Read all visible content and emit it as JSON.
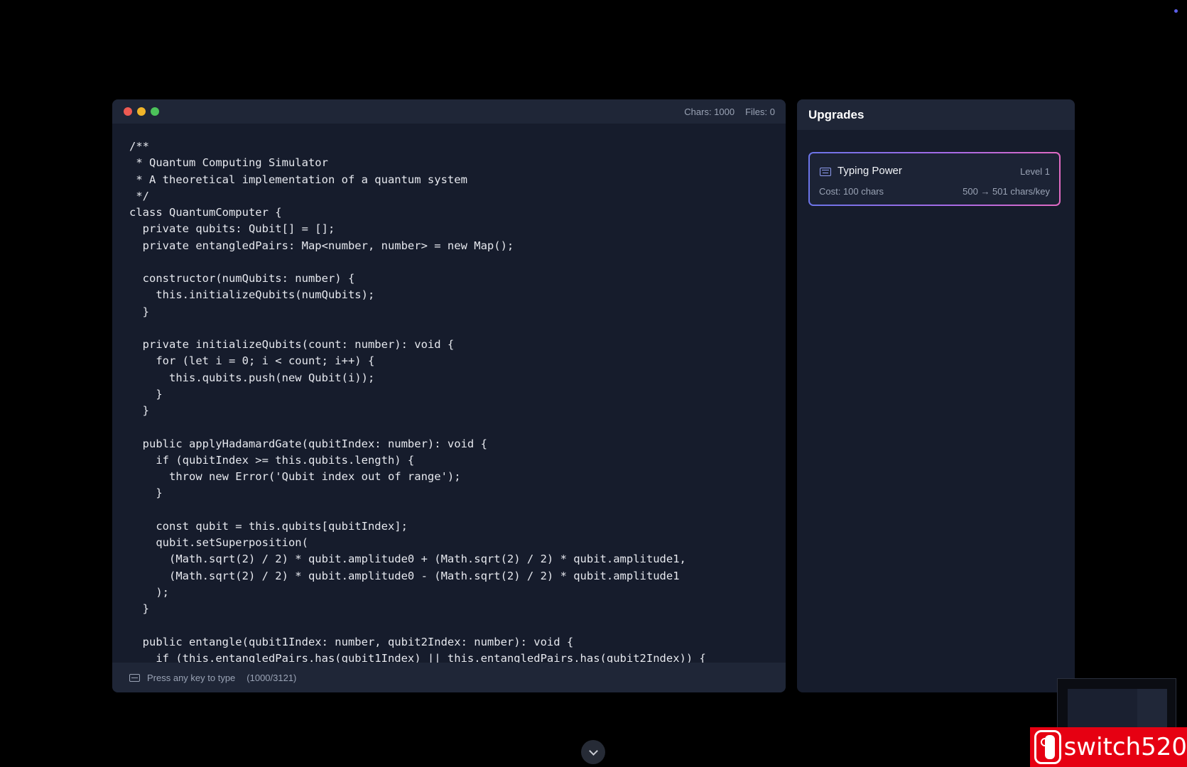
{
  "editor": {
    "stats": {
      "chars": "Chars: 1000",
      "files": "Files: 0"
    },
    "code": "/**\n * Quantum Computing Simulator\n * A theoretical implementation of a quantum system\n */\nclass QuantumComputer {\n  private qubits: Qubit[] = [];\n  private entangledPairs: Map<number, number> = new Map();\n\n  constructor(numQubits: number) {\n    this.initializeQubits(numQubits);\n  }\n\n  private initializeQubits(count: number): void {\n    for (let i = 0; i < count; i++) {\n      this.qubits.push(new Qubit(i));\n    }\n  }\n\n  public applyHadamardGate(qubitIndex: number): void {\n    if (qubitIndex >= this.qubits.length) {\n      throw new Error('Qubit index out of range');\n    }\n\n    const qubit = this.qubits[qubitIndex];\n    qubit.setSuperposition(\n      (Math.sqrt(2) / 2) * qubit.amplitude0 + (Math.sqrt(2) / 2) * qubit.amplitude1,\n      (Math.sqrt(2) / 2) * qubit.amplitude0 - (Math.sqrt(2) / 2) * qubit.amplitude1\n    );\n  }\n\n  public entangle(qubit1Index: number, qubit2Index: number): void {\n    if (this.entangledPairs.has(qubit1Index) || this.entangledPairs.has(qubit2Index)) {",
    "footer": {
      "hint": "Press any key to type",
      "progress": "(1000/3121)",
      "icon": "keyboard-icon"
    },
    "window_dots": [
      "#ee5a52",
      "#f0b429",
      "#4cc25a"
    ]
  },
  "upgrades": {
    "title": "Upgrades",
    "items": [
      {
        "name": "Typing Power",
        "level": "Level 1",
        "cost": "Cost: 100 chars",
        "effect": "500 → 501 chars/key",
        "icon": "keyboard-icon"
      }
    ]
  },
  "watermark": {
    "text": "switch520"
  },
  "colors": {
    "background": "#000000",
    "panel": "#161c2c",
    "panel_header": "#1f2637",
    "accent_gradient": [
      "#6b74e8",
      "#a66be8",
      "#e06ac2"
    ]
  }
}
